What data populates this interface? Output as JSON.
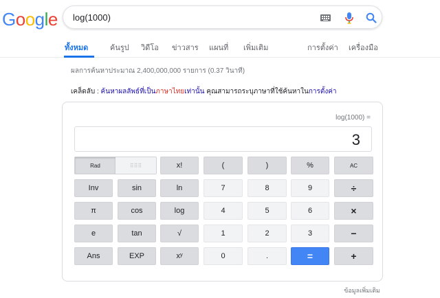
{
  "logo": {
    "letters": [
      {
        "ch": "G",
        "color": "#4285f4"
      },
      {
        "ch": "o",
        "color": "#ea4335"
      },
      {
        "ch": "o",
        "color": "#fbbc05"
      },
      {
        "ch": "g",
        "color": "#4285f4"
      },
      {
        "ch": "l",
        "color": "#34a853"
      },
      {
        "ch": "e",
        "color": "#ea4335"
      }
    ]
  },
  "search": {
    "query": "log(1000)",
    "icons": [
      "keyboard-icon",
      "mic-icon",
      "search-icon"
    ]
  },
  "tabs": {
    "all": "ทั้งหมด",
    "images": "ค้นรูป",
    "videos": "วิดีโอ",
    "news": "ข่าวสาร",
    "maps": "แผนที่",
    "more": "เพิ่มเติม",
    "settings": "การตั้งค่า",
    "tools": "เครื่องมือ"
  },
  "stats": "ผลการค้นหาประมาณ 2,400,000,000 รายการ (0.37 วินาที)",
  "tip": {
    "prefix": "เคล็ดลับ :",
    "link1": "ค้นหาผลลัพธ์ที่เป็น",
    "lang": "ภาษาไทย",
    "link2": "เท่านั้น",
    "middle": " คุณสามารถระบุภาษาที่ใช้ค้นหาใน",
    "settings_link": "การตั้งค่า"
  },
  "calculator": {
    "expression": "log(1000) =",
    "result": "3",
    "rad": "Rad",
    "deg": "⠿⠿⠿",
    "keys": {
      "fact": "x!",
      "lparen": "(",
      "rparen": ")",
      "percent": "%",
      "ac": "AC",
      "inv": "Inv",
      "sin": "sin",
      "ln": "ln",
      "n7": "7",
      "n8": "8",
      "n9": "9",
      "div": "÷",
      "pi": "π",
      "cos": "cos",
      "log": "log",
      "n4": "4",
      "n5": "5",
      "n6": "6",
      "mul": "×",
      "e": "e",
      "tan": "tan",
      "sqrt": "√",
      "n1": "1",
      "n2": "2",
      "n3": "3",
      "minus": "−",
      "ans": "Ans",
      "exp": "EXP",
      "pow": "xʸ",
      "n0": "0",
      "dot": ".",
      "eq": "=",
      "plus": "+"
    }
  },
  "more_info": "ข้อมูลเพิ่มเติม"
}
